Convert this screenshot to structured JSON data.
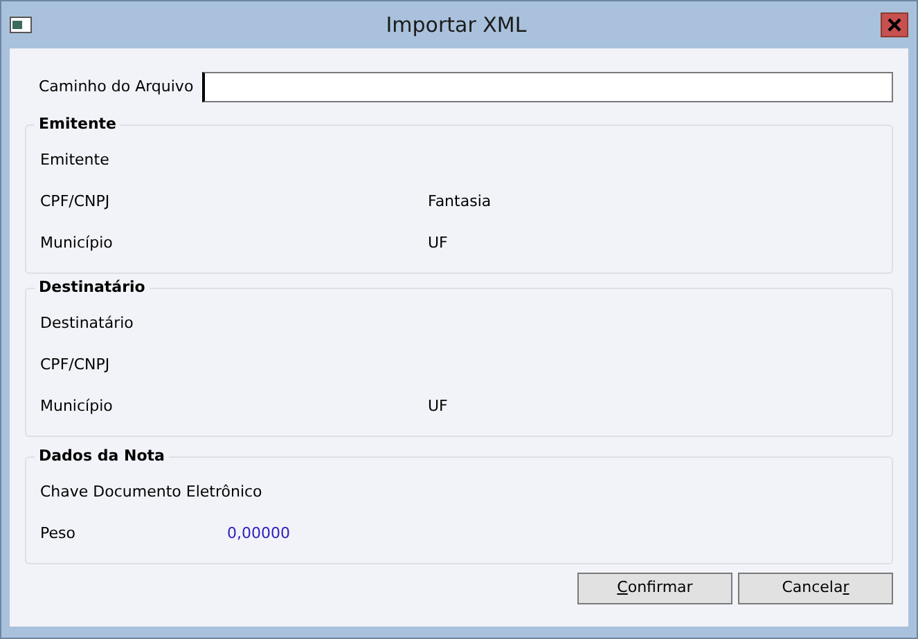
{
  "window": {
    "title": "Importar XML"
  },
  "file_path": {
    "label": "Caminho do Arquivo"
  },
  "groups": [
    {
      "title": "Emitente",
      "rows": [
        [
          {
            "label": "Emitente"
          }
        ],
        [
          {
            "label": "CPF/CNPJ"
          },
          {
            "label": "Fantasia"
          }
        ],
        [
          {
            "label": "Município"
          },
          {
            "label": "UF"
          }
        ]
      ]
    },
    {
      "title": "Destinatário",
      "rows": [
        [
          {
            "label": "Destinatário"
          }
        ],
        [
          {
            "label": "CPF/CNPJ"
          }
        ],
        [
          {
            "label": "Município"
          },
          {
            "label": "UF"
          }
        ]
      ]
    },
    {
      "title": "Dados da Nota",
      "rows": [
        [
          {
            "label": "Chave Documento Eletrônico"
          }
        ],
        [
          {
            "label": "Peso",
            "value": "0,00000"
          }
        ]
      ]
    }
  ],
  "buttons": [
    {
      "label_parts": [
        {
          "text": "C",
          "underlined": true
        },
        {
          "text": "onfirmar",
          "underlined": false
        }
      ]
    },
    {
      "label_parts": [
        {
          "text": "Cancela",
          "underlined": false
        },
        {
          "text": "r",
          "underlined": true
        }
      ]
    }
  ]
}
